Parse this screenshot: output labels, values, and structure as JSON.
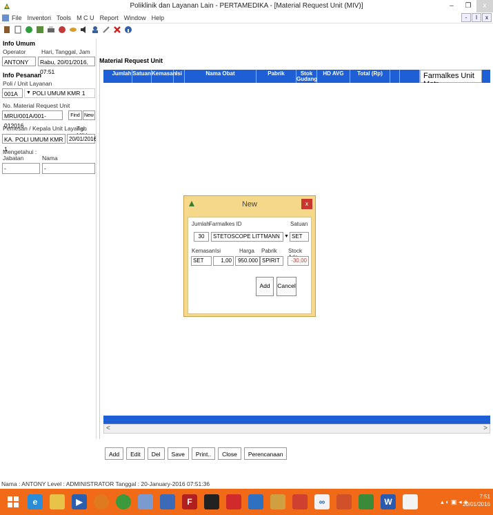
{
  "window": {
    "title": "Poliklinik dan Layanan Lain - PERTAMEDIKA - [Material Request Unit (MIV)]",
    "min_label": "–",
    "max_label": "❐",
    "close_label": "x"
  },
  "menu": {
    "items": [
      "File",
      "Inventori",
      "Tools",
      "M C U",
      "Report",
      "Window",
      "Help"
    ],
    "mdi_min": "-",
    "mdi_restore": "ǀ",
    "mdi_close": "x"
  },
  "toolbar": {
    "icons": [
      "door-icon",
      "page-icon",
      "green-circle-icon",
      "report-icon",
      "printer-icon",
      "heart-icon",
      "pill-icon",
      "sound-icon",
      "user-icon",
      "tools-icon",
      "close-icon",
      "info-icon"
    ]
  },
  "left": {
    "info_umum_title": "Info Umum",
    "operator_label": "Operator",
    "date_label": "Hari, Tanggal, Jam",
    "operator_value": "ANTONY",
    "date_value": "Rabu, 20/01/2016, 07:51",
    "info_pesanan_title": "Info Pesanan",
    "poli_label": "Poli / Unit Layanan",
    "poli_code": "001A",
    "poli_name": "POLI UMUM KMR 1",
    "mru_label": "No. Material Request Unit",
    "mru_value": "MRU/001A/001-012016",
    "find_label": "Find",
    "new_label": "New",
    "pemesan_label": "Pemesan / Kepala Unit Layanan",
    "tgl_label": "Tgl. MIV",
    "pemesan_value": "KA. POLI UMUM KMR 1",
    "tgl_value": "20/01/2016",
    "mengetahui_label": "Mengetahui :",
    "jabatan_label": "Jabatan",
    "nama_label": "Nama",
    "jabatan_value": "-",
    "nama_value": "-"
  },
  "main": {
    "title": "Material Request Unit",
    "columns": [
      "Jumlah",
      "Satuan",
      "Kemasan",
      "Isi",
      "Nama Obat",
      "Pabrik",
      "Stok Gudang",
      "HD AVG",
      "Total (Rp)",
      "",
      ""
    ],
    "farmalkes_header": "Farmalkes Unit Matr",
    "scroll_left": "<",
    "scroll_right": ">"
  },
  "buttons": [
    "Add",
    "Edit",
    "Del",
    "Save",
    "Print..",
    "Close",
    "Perencanaan"
  ],
  "status": "Nama : ANTONY    Level : ADMINISTRATOR    Tanggal : 20-January-2016  07:51:36",
  "dialog": {
    "title": "New",
    "close": "x",
    "jumlah_label": "Jumlah",
    "farmalkes_label": "Farmalkes ID",
    "satuan_label": "Satuan",
    "jumlah_value": "30",
    "farmalkes_value": "STETOSCOPE LITTMANN",
    "satuan_value": "SET",
    "kemasan_label": "Kemasan",
    "isi_label": "Isi",
    "harga_label": "Harga",
    "pabrik_label": "Pabrik",
    "stock_label": "Stock Ada",
    "kemasan_value": "SET",
    "isi_value": "1,00",
    "harga_value": "950.000",
    "pabrik_value": "SPIRIT",
    "stock_value": "-30,00",
    "add_label": "Add",
    "cancel_label": "Cancel"
  },
  "taskbar": {
    "time": "7:51",
    "date": "20/01/2016",
    "apps": [
      "windows-start-icon",
      "ie-icon",
      "explorer-icon",
      "media-icon",
      "firefox-icon",
      "chrome-icon",
      "app-icon",
      "network-icon",
      "filezilla-icon",
      "terminal-icon",
      "acrobat-icon",
      "app2-icon",
      "acrobat-distiller-icon",
      "acrobat-pro-icon",
      "infinity-icon",
      "powerpoint-icon",
      "project-icon",
      "word-icon",
      "app3-icon"
    ]
  },
  "colors": {
    "grid_header": "#1e5fd6",
    "dialog_bg": "#f5d889",
    "taskbar": "#f06a17",
    "stock_negative": "#c0392b"
  }
}
